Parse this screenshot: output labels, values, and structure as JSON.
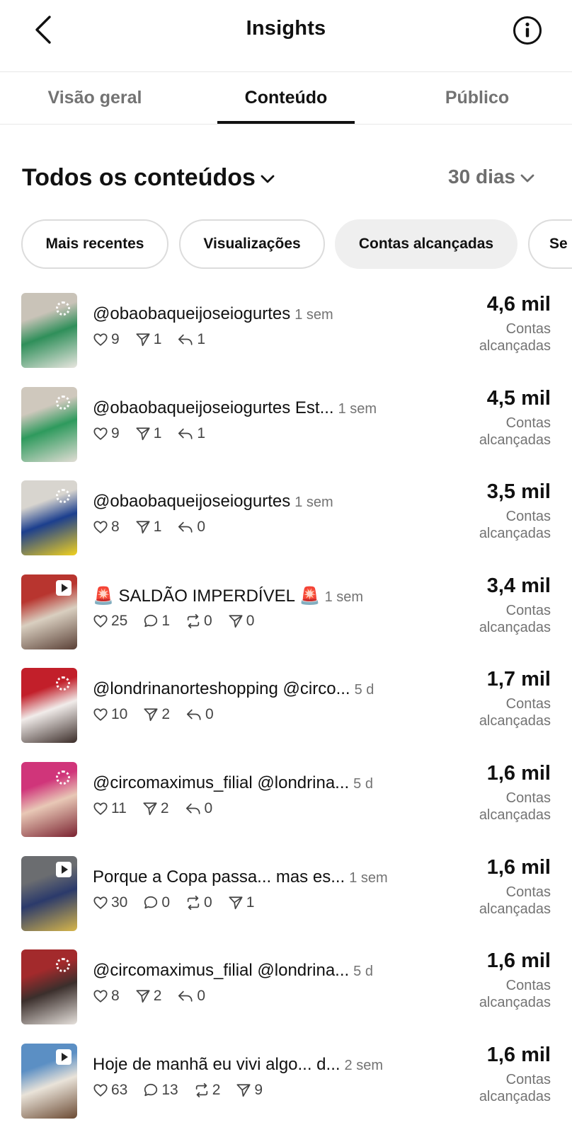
{
  "header": {
    "title": "Insights"
  },
  "tabs": [
    {
      "label": "Visão geral",
      "active": false
    },
    {
      "label": "Conteúdo",
      "active": true
    },
    {
      "label": "Público",
      "active": false
    }
  ],
  "filter": {
    "title": "Todos os conteúdos",
    "period": "30 dias"
  },
  "pills": [
    {
      "label": "Mais recentes",
      "active": false
    },
    {
      "label": "Visualizações",
      "active": false
    },
    {
      "label": "Contas alcançadas",
      "active": true
    },
    {
      "label": "Se",
      "active": false
    }
  ],
  "metric_label": "Contas alcançadas",
  "posts": [
    {
      "caption": "@obaobaqueijoseiogurtes",
      "age": "1 sem",
      "metric": "4,6 mil",
      "type": "carousel",
      "colors": [
        "#c9c3b8",
        "#2f8f5a",
        "#e9e6e0"
      ],
      "stats": [
        {
          "icon": "heart-icon",
          "value": "9"
        },
        {
          "icon": "send-icon",
          "value": "1"
        },
        {
          "icon": "reply-icon",
          "value": "1"
        }
      ]
    },
    {
      "caption": "@obaobaqueijoseiogurtes  Est...",
      "age": "1 sem",
      "metric": "4,5 mil",
      "type": "carousel",
      "colors": [
        "#cfc8bd",
        "#2e9a5d",
        "#e2ddd5"
      ],
      "stats": [
        {
          "icon": "heart-icon",
          "value": "9"
        },
        {
          "icon": "send-icon",
          "value": "1"
        },
        {
          "icon": "reply-icon",
          "value": "1"
        }
      ]
    },
    {
      "caption": "@obaobaqueijoseiogurtes",
      "age": "1 sem",
      "metric": "3,5 mil",
      "type": "carousel",
      "colors": [
        "#d8d5cf",
        "#1c3f8e",
        "#f2d21e"
      ],
      "stats": [
        {
          "icon": "heart-icon",
          "value": "8"
        },
        {
          "icon": "send-icon",
          "value": "1"
        },
        {
          "icon": "reply-icon",
          "value": "0"
        }
      ]
    },
    {
      "caption": "🚨 SALDÃO IMPERDÍVEL 🚨",
      "age": "1 sem",
      "metric": "3,4 mil",
      "type": "video",
      "colors": [
        "#b8352f",
        "#d9cfc0",
        "#5a4036"
      ],
      "stats": [
        {
          "icon": "heart-icon",
          "value": "25"
        },
        {
          "icon": "comment-icon",
          "value": "1"
        },
        {
          "icon": "repost-icon",
          "value": "0"
        },
        {
          "icon": "send-icon",
          "value": "0"
        }
      ]
    },
    {
      "caption": "@londrinanorteshopping  @circo...",
      "age": "5 d",
      "metric": "1,7 mil",
      "type": "carousel",
      "colors": [
        "#c21f2a",
        "#f1ecea",
        "#3a2c28"
      ],
      "stats": [
        {
          "icon": "heart-icon",
          "value": "10"
        },
        {
          "icon": "send-icon",
          "value": "2"
        },
        {
          "icon": "reply-icon",
          "value": "0"
        }
      ]
    },
    {
      "caption": "@circomaximus_filial  @londrina...",
      "age": "5 d",
      "metric": "1,6 mil",
      "type": "carousel",
      "colors": [
        "#d0357a",
        "#e8c8b6",
        "#7a2230"
      ],
      "stats": [
        {
          "icon": "heart-icon",
          "value": "11"
        },
        {
          "icon": "send-icon",
          "value": "2"
        },
        {
          "icon": "reply-icon",
          "value": "0"
        }
      ]
    },
    {
      "caption": "Porque a Copa passa... mas es...",
      "age": "1 sem",
      "metric": "1,6 mil",
      "type": "video",
      "colors": [
        "#6b6d70",
        "#2b3a6b",
        "#d7b64a"
      ],
      "stats": [
        {
          "icon": "heart-icon",
          "value": "30"
        },
        {
          "icon": "comment-icon",
          "value": "0"
        },
        {
          "icon": "repost-icon",
          "value": "0"
        },
        {
          "icon": "send-icon",
          "value": "1"
        }
      ]
    },
    {
      "caption": "@circomaximus_filial @londrina...",
      "age": "5 d",
      "metric": "1,6 mil",
      "type": "carousel",
      "colors": [
        "#a32a2c",
        "#3b2f2c",
        "#e6e1dc"
      ],
      "stats": [
        {
          "icon": "heart-icon",
          "value": "8"
        },
        {
          "icon": "send-icon",
          "value": "2"
        },
        {
          "icon": "reply-icon",
          "value": "0"
        }
      ]
    },
    {
      "caption": "Hoje de manhã eu vivi algo... d...",
      "age": "2 sem",
      "metric": "1,6 mil",
      "type": "video",
      "colors": [
        "#5b8fc4",
        "#e9e3d9",
        "#6b4a33"
      ],
      "stats": [
        {
          "icon": "heart-icon",
          "value": "63"
        },
        {
          "icon": "comment-icon",
          "value": "13"
        },
        {
          "icon": "repost-icon",
          "value": "2"
        },
        {
          "icon": "send-icon",
          "value": "9"
        }
      ]
    }
  ]
}
